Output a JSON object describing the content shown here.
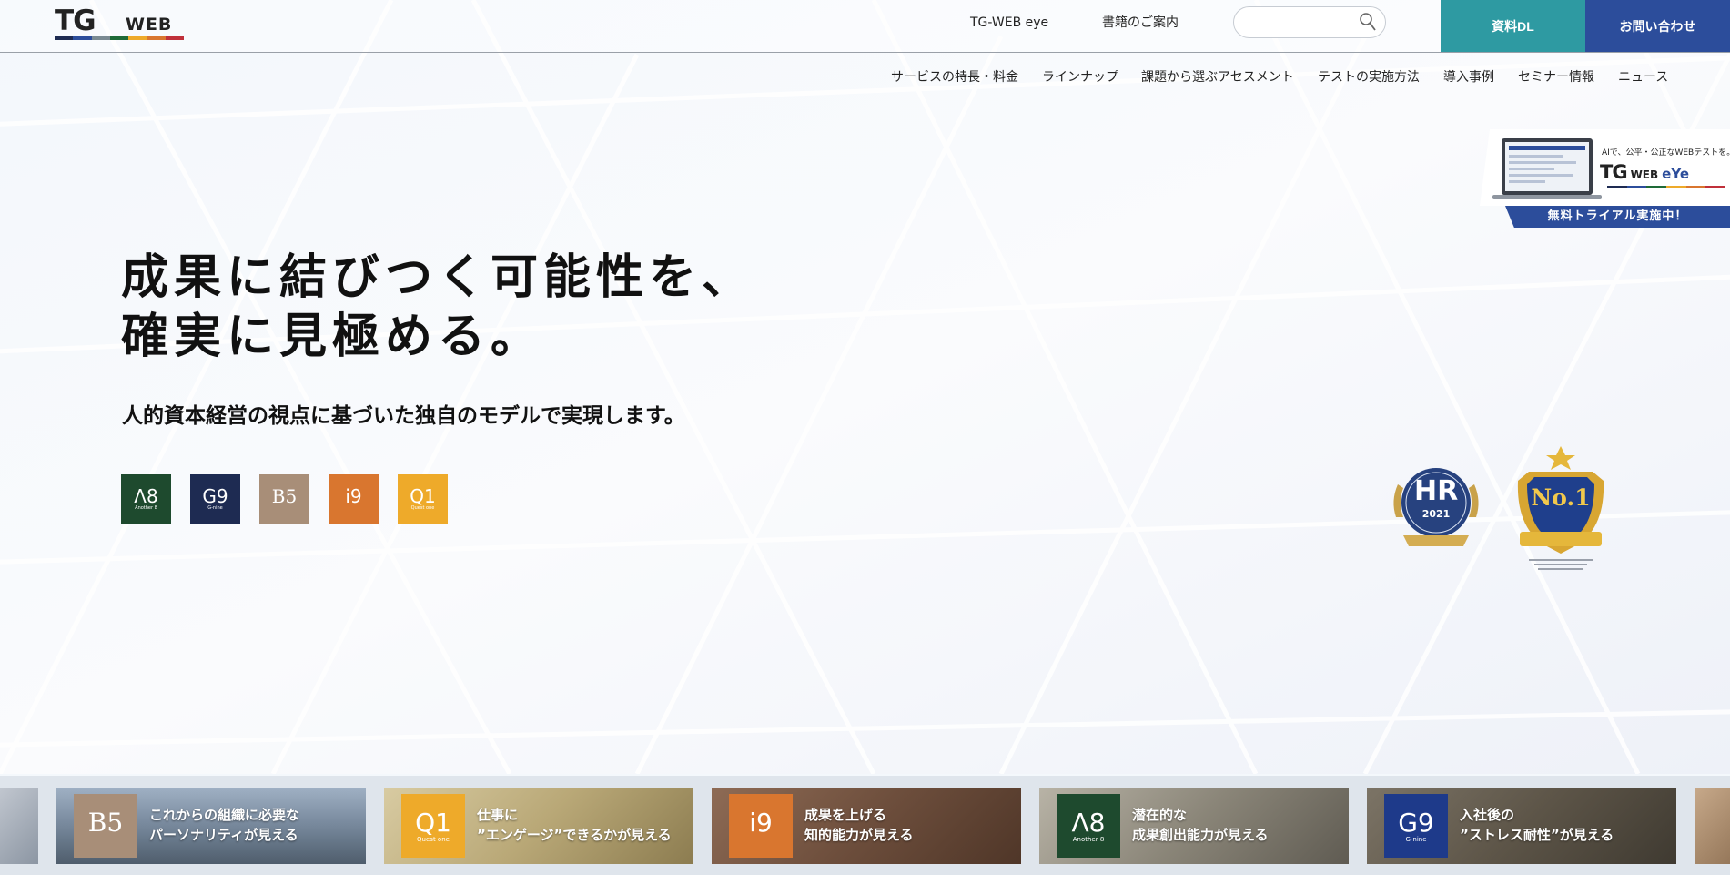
{
  "colors": {
    "teal": "#2e9aa2",
    "navy": "#2c4d9b",
    "a8_green": "#1e4a2e",
    "g9_navy": "#1e2b52",
    "b5_tan": "#a88e78",
    "i9_orange": "#d9762f",
    "q1_yellow": "#eeaa2a"
  },
  "header": {
    "logo_tg": "TG",
    "logo_web": "WEB",
    "links": [
      "TG-WEB eye",
      "書籍のご案内"
    ],
    "search": {
      "value": "",
      "placeholder": ""
    },
    "download_label": "資料DL",
    "contact_label": "お問い合わせ"
  },
  "nav": {
    "items": [
      "サービスの特長・料金",
      "ラインナップ",
      "課題から選ぶアセスメント",
      "テストの実施方法",
      "導入事例",
      "セミナー情報",
      "ニュース"
    ]
  },
  "promo": {
    "caption": "AIで、公平・公正なWEBテストを。",
    "logo_tg": "TG",
    "logo_web": "WEB",
    "logo_eye": "eYe",
    "cta": "無料トライアル実施中！"
  },
  "hero": {
    "title_line1": "成果に結びつく可能性を、",
    "title_line2": "確実に見極める。",
    "subtitle": "人的資本経営の視点に基づいた独自のモデルで実現します。"
  },
  "products": [
    {
      "name": "Λ8",
      "sub": "Another 8"
    },
    {
      "name": "G9",
      "sub": "G-nine"
    },
    {
      "name": "B5",
      "sub": ""
    },
    {
      "name": "i9",
      "sub": ""
    },
    {
      "name": "Q1",
      "sub": "Quest one"
    }
  ],
  "awards": {
    "hr_text": "HR",
    "hr_year": "2021",
    "no1_text": "No.1"
  },
  "cards": [
    {
      "name": "B5",
      "sub": "",
      "line1": "これからの組織に必要な",
      "line2": "パーソナリティが見える"
    },
    {
      "name": "Q1",
      "sub": "Quest one",
      "line1": "仕事に",
      "line2": "”エンゲージ”できるかが見える"
    },
    {
      "name": "i9",
      "sub": "",
      "line1": "成果を上げる",
      "line2": "知的能力が見える"
    },
    {
      "name": "Λ8",
      "sub": "Another 8",
      "line1": "潜在的な",
      "line2": "成果創出能力が見える"
    },
    {
      "name": "G9",
      "sub": "G-nine",
      "line1": "入社後の",
      "line2": "”ストレス耐性”が見える"
    }
  ]
}
